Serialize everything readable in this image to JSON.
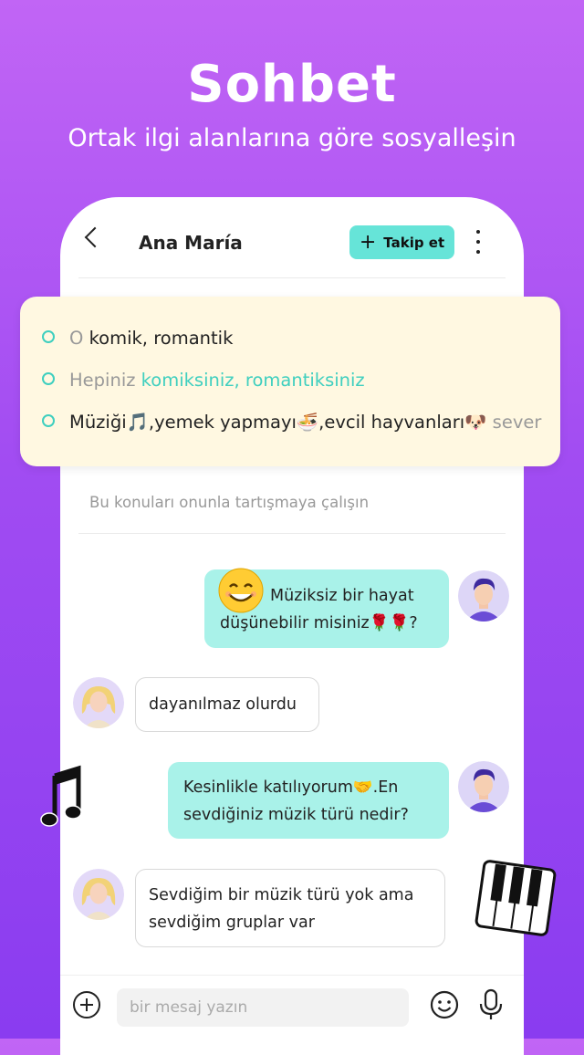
{
  "header": {
    "title": "Sohbet",
    "subtitle": "Ortak ilgi alanlarına göre sosyalleşin"
  },
  "chat": {
    "contact_name": "Ana María",
    "follow_label": "Takip et",
    "tip_text": "Bu konuları onunla tartışmaya çalışın",
    "input_placeholder": "bir mesaj yazın"
  },
  "tips": [
    {
      "prefix": "O",
      "text": "komik, romantik",
      "suffix": ""
    },
    {
      "prefix": "Hepiniz",
      "text": "komiksiniz, romantiksiniz",
      "suffix": ""
    },
    {
      "prefix": "",
      "text": "Müziği🎵,yemek yapmayı🍜,evcil hayvanları🐶",
      "suffix": "sever"
    }
  ],
  "messages": [
    {
      "side": "out",
      "lines": [
        "Müziksiz bir hayat",
        "düşünebilir misiniz🌹🌹?"
      ]
    },
    {
      "side": "in",
      "lines": [
        "dayanılmaz olurdu"
      ]
    },
    {
      "side": "out",
      "lines": [
        "Kesinlikle katılıyorum🤝.En",
        "sevdiğiniz müzik türü nedir?"
      ]
    },
    {
      "side": "in",
      "lines": [
        "Sevdiğim bir müzik türü yok ama",
        "sevdiğim gruplar var"
      ]
    }
  ],
  "colors": {
    "accent": "#66e4d8",
    "bubble_out": "#a9f2e9",
    "card_bg": "#fff8e1",
    "bg_top": "#c165f5",
    "bg_bottom": "#8a3cf0"
  },
  "icons": [
    "back-icon",
    "plus-icon",
    "more-icon",
    "smile-icon",
    "microphone-icon",
    "add-icon",
    "music-note-icon",
    "piano-icon"
  ]
}
